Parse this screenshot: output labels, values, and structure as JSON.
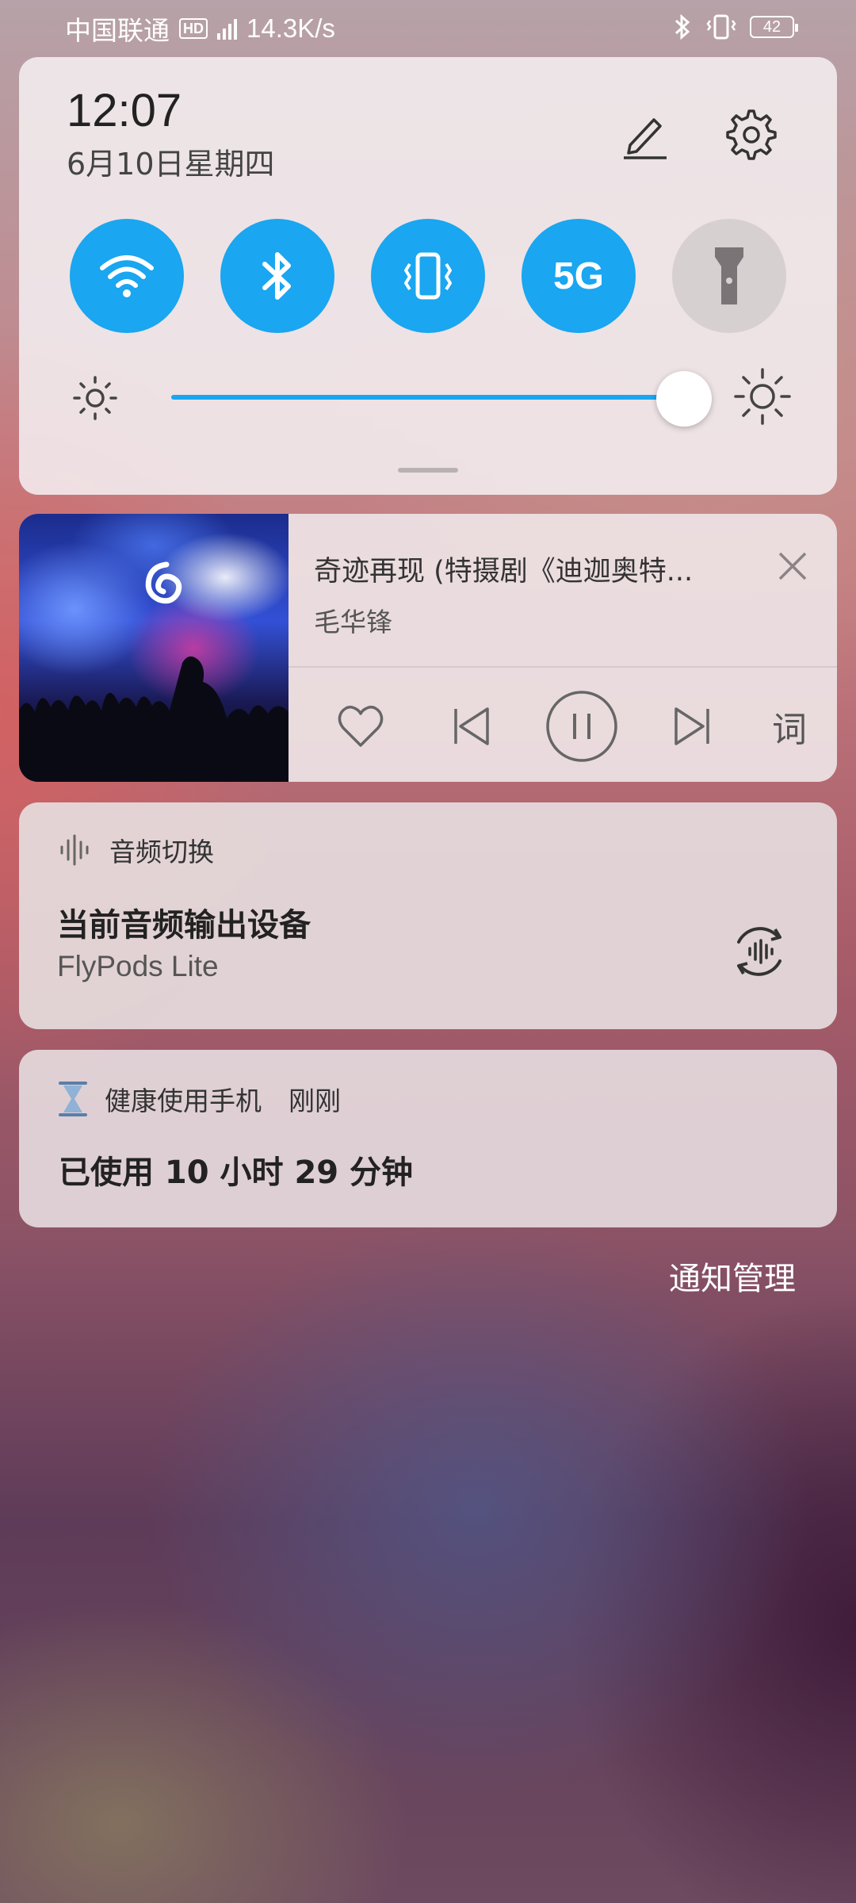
{
  "status_bar": {
    "carrier": "中国联通",
    "hd_badge": "HD",
    "network_speed": "14.3K/s",
    "battery_level": "42",
    "icons": [
      "hd-icon",
      "signal-5g-icon",
      "bluetooth-icon",
      "vibrate-icon",
      "battery-icon"
    ]
  },
  "quick_panel": {
    "time": "12:07",
    "date": "6月10日星期四",
    "header_icons": [
      "edit-icon",
      "settings-icon"
    ],
    "toggles": [
      {
        "name": "wifi",
        "icon": "wifi-icon",
        "active": true
      },
      {
        "name": "bluetooth",
        "icon": "bluetooth-icon",
        "active": true
      },
      {
        "name": "vibrate",
        "icon": "vibrate-icon",
        "active": true
      },
      {
        "name": "5g",
        "label": "5G",
        "active": true
      },
      {
        "name": "flashlight",
        "icon": "flashlight-icon",
        "active": false
      }
    ],
    "brightness_level": 0.93,
    "accent_color": "#1aa6f0"
  },
  "music": {
    "title": "奇迹再现 (特摄剧《迪迦奥特...",
    "artist": "毛华锋",
    "lyrics_label": "词",
    "state": "playing"
  },
  "audio_switch": {
    "header": "音频切换",
    "title": "当前音频输出设备",
    "device": "FlyPods Lite"
  },
  "health": {
    "app": "健康使用手机",
    "time": "刚刚",
    "message": "已使用 10 小时 29 分钟"
  },
  "notification_management": "通知管理"
}
